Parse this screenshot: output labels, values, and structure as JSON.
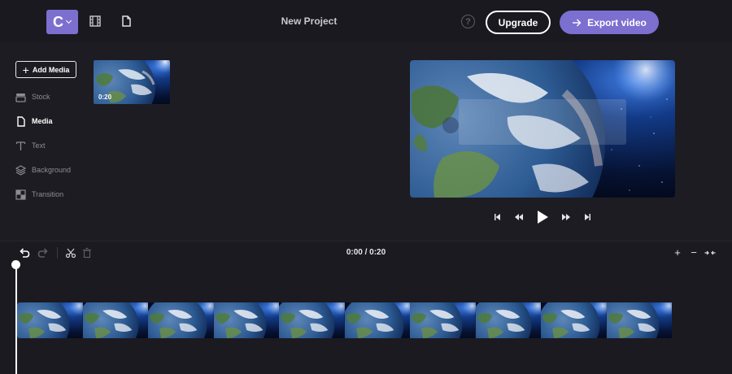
{
  "topbar": {
    "logo_letter": "C",
    "project_title": "New Project",
    "help_glyph": "?",
    "upgrade_label": "Upgrade",
    "export_label": "Export video",
    "icons": [
      "film-icon",
      "file-icon",
      "help-icon",
      "arrow-right-icon",
      "chevron-down-icon"
    ]
  },
  "sidebar": {
    "add_media_label": "Add Media",
    "items": [
      {
        "label": "Stock",
        "icon": "stock-icon",
        "active": false
      },
      {
        "label": "Media",
        "icon": "media-file-icon",
        "active": true
      },
      {
        "label": "Text",
        "icon": "text-icon",
        "active": false
      },
      {
        "label": "Background",
        "icon": "layers-icon",
        "active": false
      },
      {
        "label": "Transition",
        "icon": "transition-icon",
        "active": false
      }
    ]
  },
  "library": {
    "items": [
      {
        "duration": "0:20",
        "thumbnail": "earth-globe"
      }
    ]
  },
  "timeline": {
    "timecode": "0:00 / 0:20",
    "zoom_in": "+",
    "zoom_out": "−",
    "fit": "→←",
    "frames": 10
  },
  "colors": {
    "accent": "#7b6fd0",
    "background": "#1d1c22",
    "topbar": "#1a1920"
  }
}
